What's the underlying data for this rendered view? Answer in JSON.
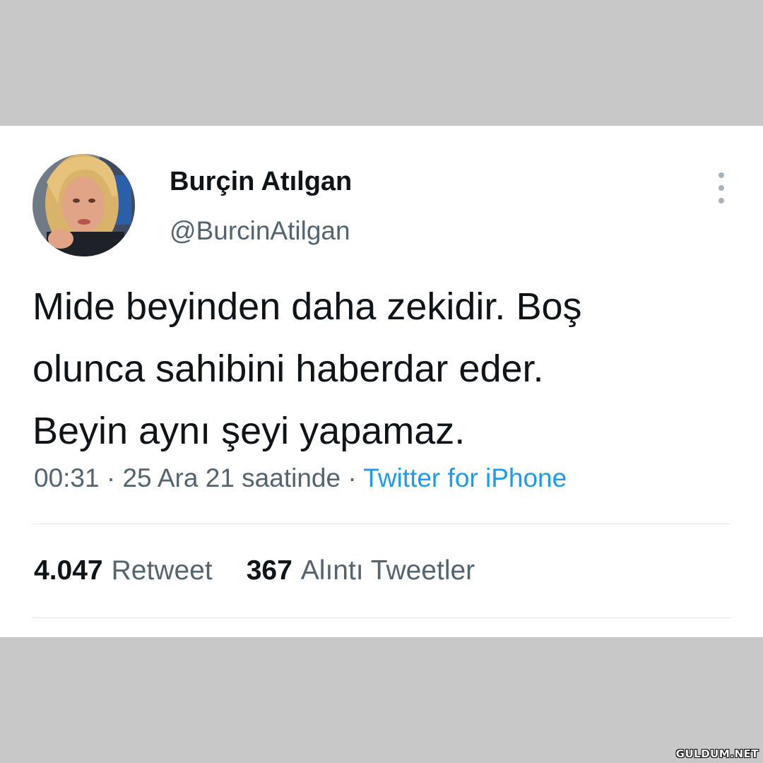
{
  "tweet": {
    "display_name": "Burçin Atılgan",
    "handle": "@BurcinAtilgan",
    "text_lines": [
      "Mide beyinden daha zekidir. Boş",
      "olunca sahibini haberdar eder.",
      "Beyin aynı şeyi yapamaz."
    ],
    "time": "00:31",
    "separator": "·",
    "date": "25 Ara 21 saatinde",
    "source": "Twitter for iPhone",
    "stats": {
      "retweets_count": "4.047",
      "retweets_label": "Retweet",
      "quotes_count": "367",
      "quotes_label": "Alıntı Tweetler"
    },
    "more_icon": "more-vertical-icon",
    "avatar_icon": "profile-photo"
  },
  "colors": {
    "background": "#c8c8c8",
    "card": "#ffffff",
    "text": "#0f1419",
    "secondary": "#536471",
    "link": "#1d9bf0"
  },
  "watermark": "GULDUM.NET"
}
